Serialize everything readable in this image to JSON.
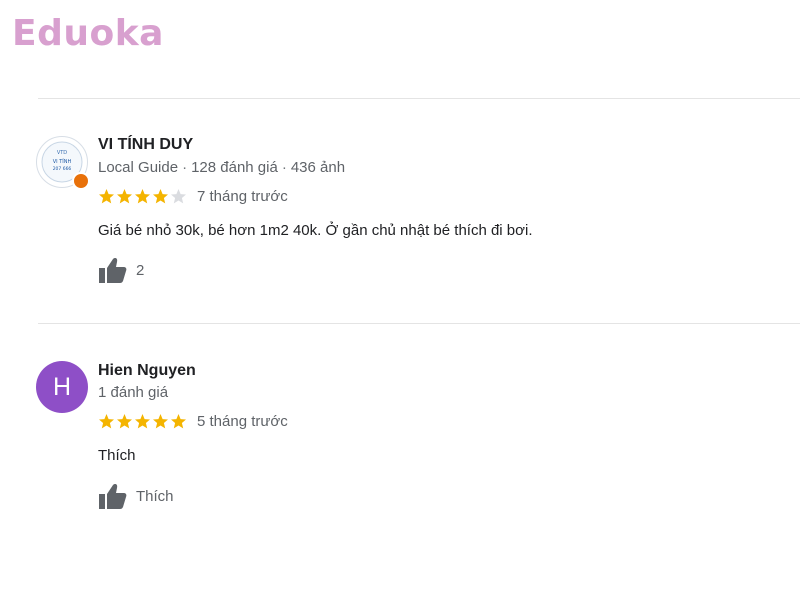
{
  "logo": {
    "text": "Eduoka",
    "color": "#d8a0cf"
  },
  "colors": {
    "star_filled": "#f4b400",
    "star_empty": "#dadce0",
    "divider": "#e4e4e4",
    "avatar_purple": "#8e4fc7"
  },
  "reviews": [
    {
      "author": "VI TÍNH DUY",
      "avatar_type": "photo",
      "avatar_icon": "reviewer-photo-icon",
      "badge_icon": "local-guide-badge-icon",
      "meta_role": "Local Guide",
      "meta_reviews": "128 đánh giá",
      "meta_photos": "436 ảnh",
      "stars": 4,
      "time": "7 tháng trước",
      "text": "Giá bé nhỏ 30k, bé hơn 1m2 40k. Ở gần chủ nhật bé thích đi bơi.",
      "like_label": "2"
    },
    {
      "author": "Hien Nguyen",
      "avatar_type": "letter",
      "avatar_letter": "H",
      "meta_reviews": "1 đánh giá",
      "stars": 5,
      "time": "5 tháng trước",
      "text": "Thích",
      "like_label": "Thích"
    }
  ]
}
